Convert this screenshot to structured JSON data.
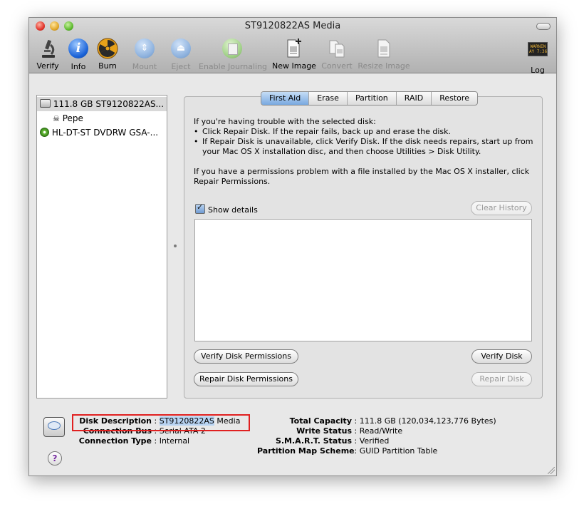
{
  "window": {
    "title": "ST9120822AS Media"
  },
  "toolbar": {
    "items": [
      {
        "label": "Verify",
        "icon": "microscope-icon",
        "enabled": true
      },
      {
        "label": "Info",
        "icon": "info-icon",
        "enabled": true
      },
      {
        "label": "Burn",
        "icon": "burn-icon",
        "enabled": true
      },
      {
        "label": "Mount",
        "icon": "mount-icon",
        "enabled": false
      },
      {
        "label": "Eject",
        "icon": "eject-icon",
        "enabled": false
      },
      {
        "label": "Enable Journaling",
        "icon": "journaling-icon",
        "enabled": false
      },
      {
        "label": "New Image",
        "icon": "new-image-icon",
        "enabled": true
      },
      {
        "label": "Convert",
        "icon": "convert-icon",
        "enabled": false
      },
      {
        "label": "Resize Image",
        "icon": "resize-image-icon",
        "enabled": false
      }
    ],
    "log": {
      "label": "Log",
      "icon": "log-icon",
      "screen_text": "WARNIN\nAY 7:36"
    }
  },
  "sidebar": {
    "items": [
      {
        "label": "111.8 GB ST9120822AS...",
        "icon": "hard-disk-icon",
        "selected": true
      },
      {
        "label": "Pepe",
        "icon": "volume-icon",
        "selected": false
      },
      {
        "label": "HL-DT-ST DVDRW GSA-...",
        "icon": "optical-drive-icon",
        "selected": false
      }
    ]
  },
  "tabs": [
    {
      "label": "First Aid",
      "active": true
    },
    {
      "label": "Erase",
      "active": false
    },
    {
      "label": "Partition",
      "active": false
    },
    {
      "label": "RAID",
      "active": false
    },
    {
      "label": "Restore",
      "active": false
    }
  ],
  "first_aid": {
    "intro": "If you're having trouble with the selected disk:",
    "bullet1": "Click Repair Disk. If the repair fails, back up and erase the disk.",
    "bullet2": "If Repair Disk is unavailable, click Verify Disk. If the disk needs repairs, start up from your Mac OS X installation disc, and then choose Utilities > Disk Utility.",
    "permissions_text": "If you have a permissions problem with a file installed by the Mac OS X installer, click Repair Permissions.",
    "show_details_label": "Show details",
    "show_details_checked": true,
    "clear_history_label": "Clear History",
    "verify_permissions_label": "Verify Disk Permissions",
    "repair_permissions_label": "Repair Disk Permissions",
    "verify_disk_label": "Verify Disk",
    "repair_disk_label": "Repair Disk"
  },
  "disk_info": {
    "left": [
      {
        "key": "Disk Description",
        "value": "ST9120822AS Media",
        "highlight": "ST9120822AS"
      },
      {
        "key": "Connection Bus",
        "value": "Serial ATA 2"
      },
      {
        "key": "Connection Type",
        "value": "Internal"
      }
    ],
    "right": [
      {
        "key": "Total Capacity",
        "value": "111.8 GB (120,034,123,776 Bytes)"
      },
      {
        "key": "Write Status",
        "value": "Read/Write"
      },
      {
        "key": "S.M.A.R.T. Status",
        "value": "Verified"
      },
      {
        "key": "Partition Map Scheme",
        "value": "GUID Partition Table"
      }
    ],
    "separator": ":"
  },
  "help_glyph": "?",
  "colors": {
    "highlight_box": "#e02020",
    "selected_tab": "#7aa9e0",
    "disabled_text": "#8a8a8a"
  }
}
